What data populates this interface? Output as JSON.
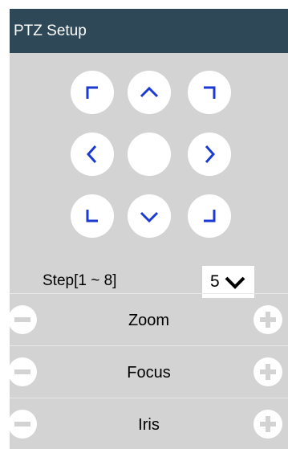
{
  "header": {
    "title": "PTZ Setup"
  },
  "dpad": {
    "buttons": [
      {
        "name": "ptz-up-left-button",
        "icon": "corner-up-left-icon"
      },
      {
        "name": "ptz-up-button",
        "icon": "chevron-up-icon"
      },
      {
        "name": "ptz-up-right-button",
        "icon": "corner-up-right-icon"
      },
      {
        "name": "ptz-left-button",
        "icon": "chevron-left-icon"
      },
      {
        "name": "ptz-center-button",
        "icon": ""
      },
      {
        "name": "ptz-right-button",
        "icon": "chevron-right-icon"
      },
      {
        "name": "ptz-down-left-button",
        "icon": "corner-down-left-icon"
      },
      {
        "name": "ptz-down-button",
        "icon": "chevron-down-icon"
      },
      {
        "name": "ptz-down-right-button",
        "icon": "corner-down-right-icon"
      }
    ],
    "icon_color": "#1a3ad1"
  },
  "step": {
    "label": "Step[1 ~ 8]",
    "value": "5"
  },
  "controls": [
    {
      "label": "Zoom"
    },
    {
      "label": "Focus"
    },
    {
      "label": "Iris"
    }
  ],
  "colors": {
    "header_bg": "#2f4858",
    "panel_bg": "#d3d3d3"
  }
}
